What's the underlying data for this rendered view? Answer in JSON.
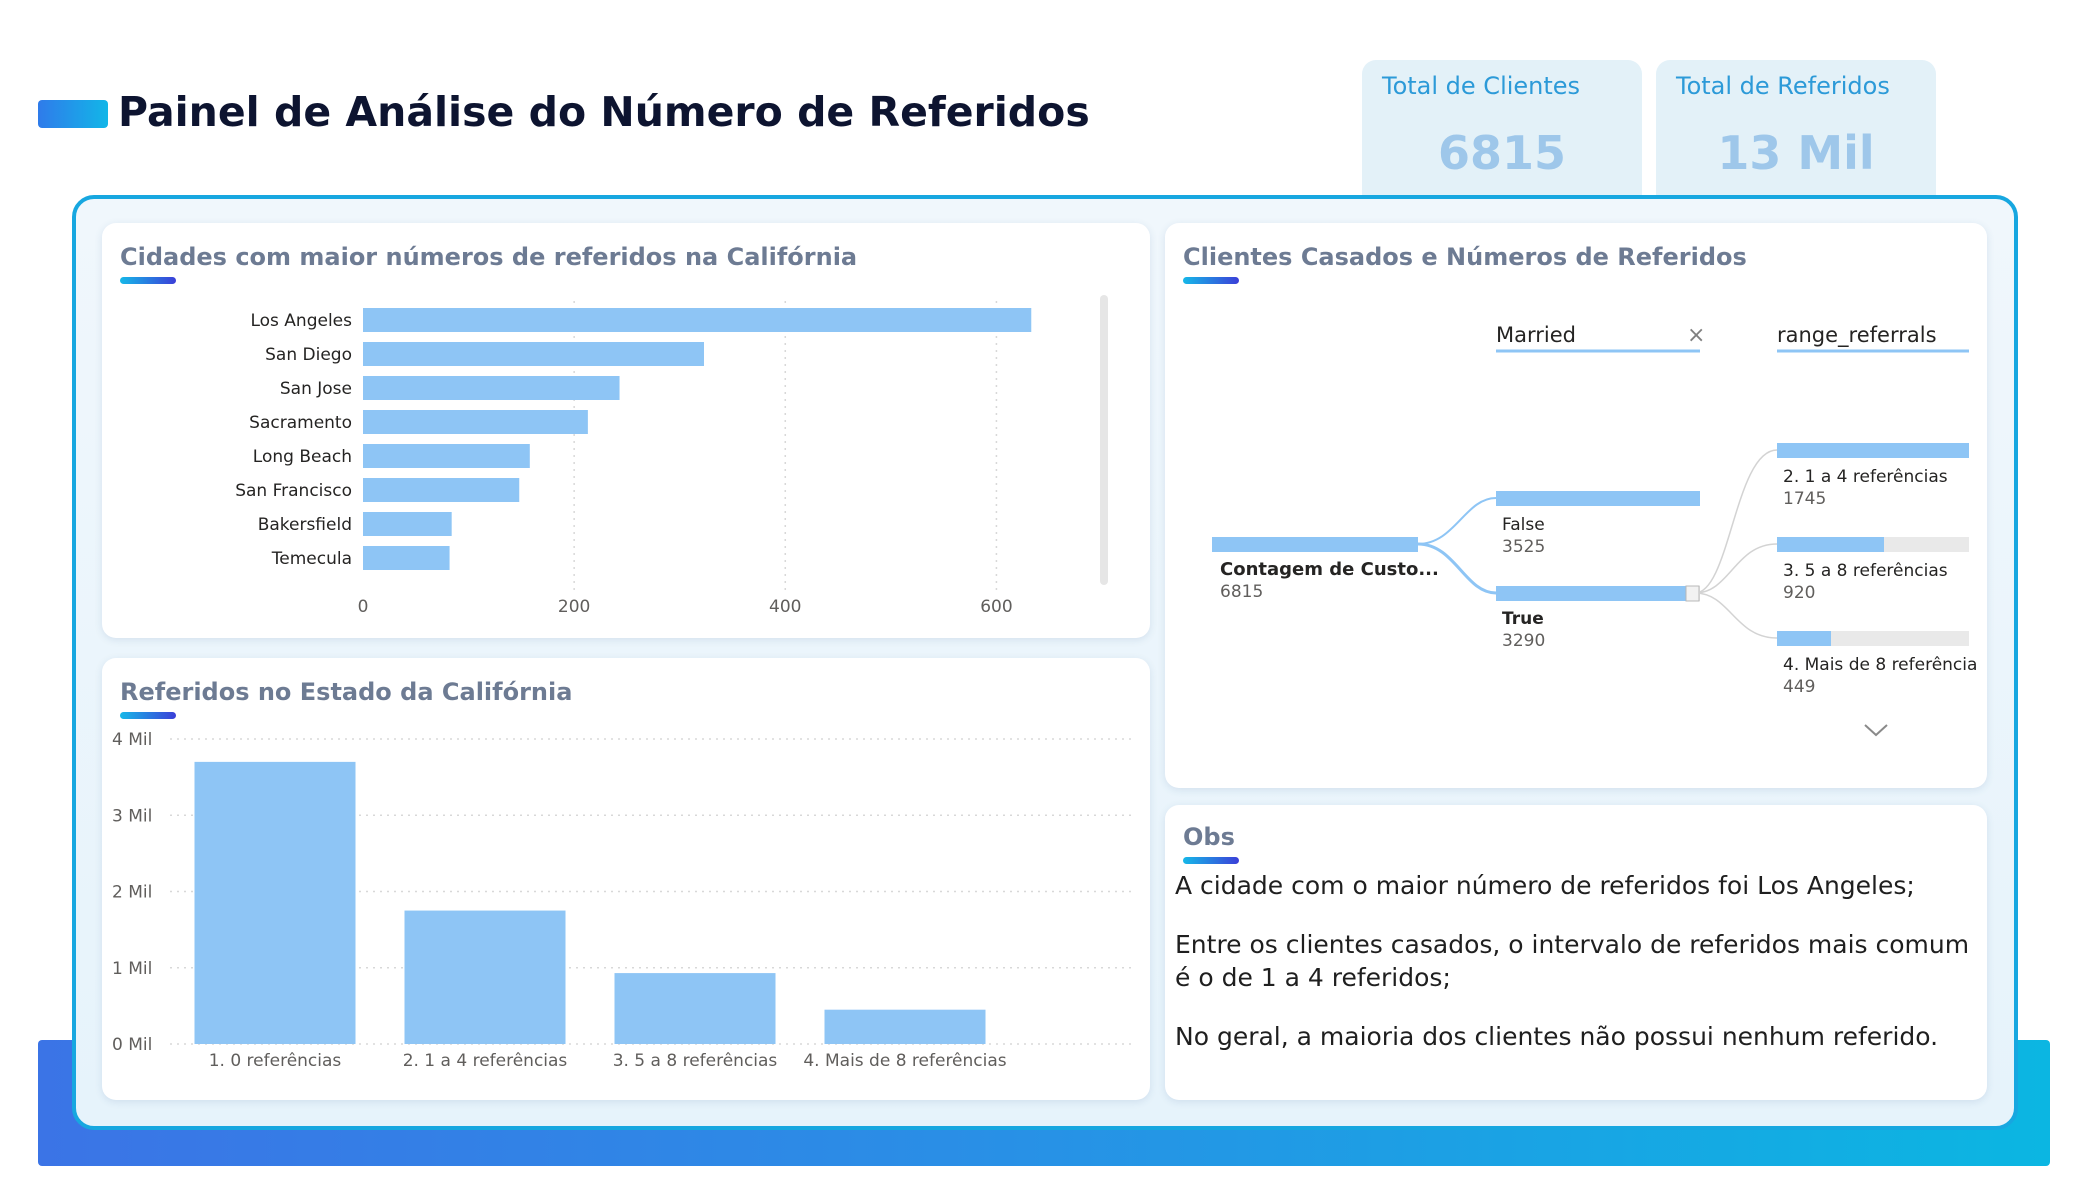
{
  "page_title": "Painel de Análise do Número de Referidos",
  "kpis": [
    {
      "label": "Total de Clientes",
      "value": "6815"
    },
    {
      "label": "Total de Referidos",
      "value": "13 Mil"
    }
  ],
  "cities_card": {
    "title": "Cidades com maior números de referidos na Califórnia"
  },
  "state_card": {
    "title": "Referidos no Estado da Califórnia"
  },
  "tree_card": {
    "title": "Clientes Casados e Números de Referidos",
    "level1_header": "Married",
    "level2_header": "range_referrals",
    "close_icon": "×",
    "root": {
      "label": "Contagem de Custo...",
      "value": "6815"
    },
    "married": [
      {
        "label": "False",
        "value": "3525"
      },
      {
        "label": "True",
        "value": "3290"
      }
    ],
    "ranges": [
      {
        "label": "2. 1 a 4 referências",
        "value": "1745"
      },
      {
        "label": "3. 5 a 8 referências",
        "value": "920"
      },
      {
        "label": "4. Mais de 8 referência",
        "value": "449"
      }
    ]
  },
  "obs_card": {
    "title": "Obs",
    "lines": [
      "A cidade com o maior número de referidos foi Los Angeles;",
      "Entre os clientes casados, o intervalo de referidos mais comum é o de 1 a 4 referidos;",
      "No geral, a maioria dos clientes não possui nenhum referido."
    ]
  },
  "colors": {
    "bar": "#8ec5f5",
    "accent": "#17a7e0",
    "kpi_value": "#9ec7ea"
  },
  "chart_data": [
    {
      "type": "bar",
      "orientation": "horizontal",
      "categories": [
        "Los Angeles",
        "San Diego",
        "San Jose",
        "Sacramento",
        "Long Beach",
        "San Francisco",
        "Bakersfield",
        "Temecula"
      ],
      "values": [
        633,
        323,
        243,
        213,
        158,
        148,
        84,
        82
      ],
      "xlim": [
        0,
        700
      ],
      "xticks": [
        0,
        200,
        400,
        600
      ],
      "xtick_labels": [
        "0",
        "200",
        "400",
        "600"
      ],
      "grid": true
    },
    {
      "type": "bar",
      "orientation": "vertical",
      "categories": [
        "1. 0 referências",
        "2. 1 a 4 referências",
        "3. 5 a 8 referências",
        "4. Mais de 8 referências"
      ],
      "values": [
        3700,
        1750,
        930,
        450
      ],
      "ylim": [
        0,
        4000
      ],
      "yticks": [
        0,
        1000,
        2000,
        3000,
        4000
      ],
      "ytick_labels": [
        "0 Mil",
        "1 Mil",
        "2 Mil",
        "3 Mil",
        "4 Mil"
      ],
      "grid": true
    }
  ]
}
